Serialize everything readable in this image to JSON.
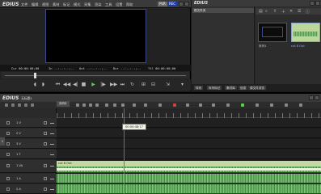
{
  "player": {
    "app_logo": "EDIUS",
    "menu": [
      "文件",
      "编辑",
      "视图",
      "素材",
      "标记",
      "模式",
      "采集",
      "渲染",
      "工具",
      "设置",
      "帮助"
    ],
    "toggle": {
      "left": "PLR",
      "right": "REC"
    },
    "timecodes": {
      "cur": "Cur 00:00:00;00",
      "in": "In --:--:--;--",
      "out": "Out --:--:--;--",
      "dur": "Dur --:--:--;--",
      "ttl": "Ttl 00:00:00;00"
    }
  },
  "bin": {
    "app_logo": "EDIUS",
    "tree_header": "根文件夹",
    "clips": [
      {
        "label": "序列1"
      },
      {
        "label": "cut 8 Out"
      }
    ],
    "tabs": [
      "特效",
      "序列标记",
      "素材库",
      "信息",
      "源文件浏览"
    ]
  },
  "timeline": {
    "app_logo": "EDIUS",
    "project_name": "无标题1",
    "sequence_tab": "序列1",
    "tooltip": "00:00:48;17",
    "side_marker": "1",
    "tracks": [
      {
        "name": "1 V",
        "kind": "video"
      },
      {
        "name": "2 V",
        "kind": "video"
      },
      {
        "name": "3 V",
        "kind": "video"
      },
      {
        "name": "1 T",
        "kind": "title"
      },
      {
        "name": "1 VA",
        "kind": "va"
      },
      {
        "name": "1 A",
        "kind": "audio"
      },
      {
        "name": "2 A",
        "kind": "audio"
      }
    ],
    "clip_label": "cut 8 Out"
  },
  "colors": {
    "accent_blue": "#3d4a8a",
    "play_green": "#5ad14b",
    "clip_green": "#c4d9a1",
    "wave_green": "#6fb96a",
    "playhead_red": "#dd4433"
  }
}
